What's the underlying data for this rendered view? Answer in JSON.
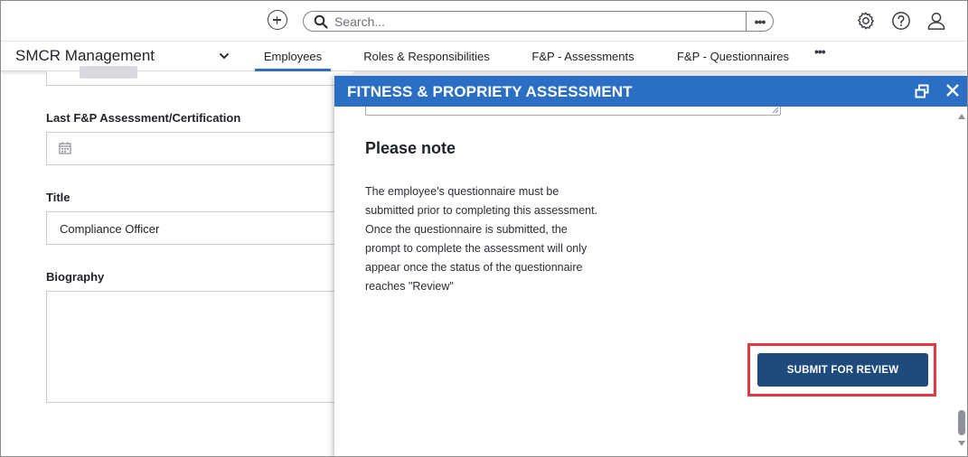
{
  "topbar": {
    "search_placeholder": "Search...",
    "add_icon": "plus-circle-icon",
    "settings_icon": "gear-icon",
    "help_icon": "question-circle-icon",
    "profile_icon": "user-icon"
  },
  "app": {
    "name": "SMCR Management"
  },
  "tabs": [
    {
      "label": "Employees",
      "active": true
    },
    {
      "label": "Roles & Responsibilities",
      "active": false
    },
    {
      "label": "F&P - Assessments",
      "active": false
    },
    {
      "label": "F&P - Questionnaires",
      "active": false
    }
  ],
  "form": {
    "last_assessment_label": "Last F&P Assessment/Certification",
    "title_label": "Title",
    "title_value": "Compliance Officer",
    "biography_label": "Biography"
  },
  "modal": {
    "title": "FITNESS & PROPRIETY ASSESSMENT",
    "note_heading": "Please note",
    "note_lines": [
      "The employee's questionnaire must be",
      "submitted prior to completing this assessment.",
      "Once the questionnaire is submitted, the",
      "prompt to complete the assessment will only",
      "appear once the status of the questionnaire",
      "reaches \"Review\""
    ],
    "submit_label": "SUBMIT FOR REVIEW"
  },
  "colors": {
    "accent": "#2a6fc4",
    "button": "#1e4a7c",
    "highlight": "#e2383f"
  }
}
